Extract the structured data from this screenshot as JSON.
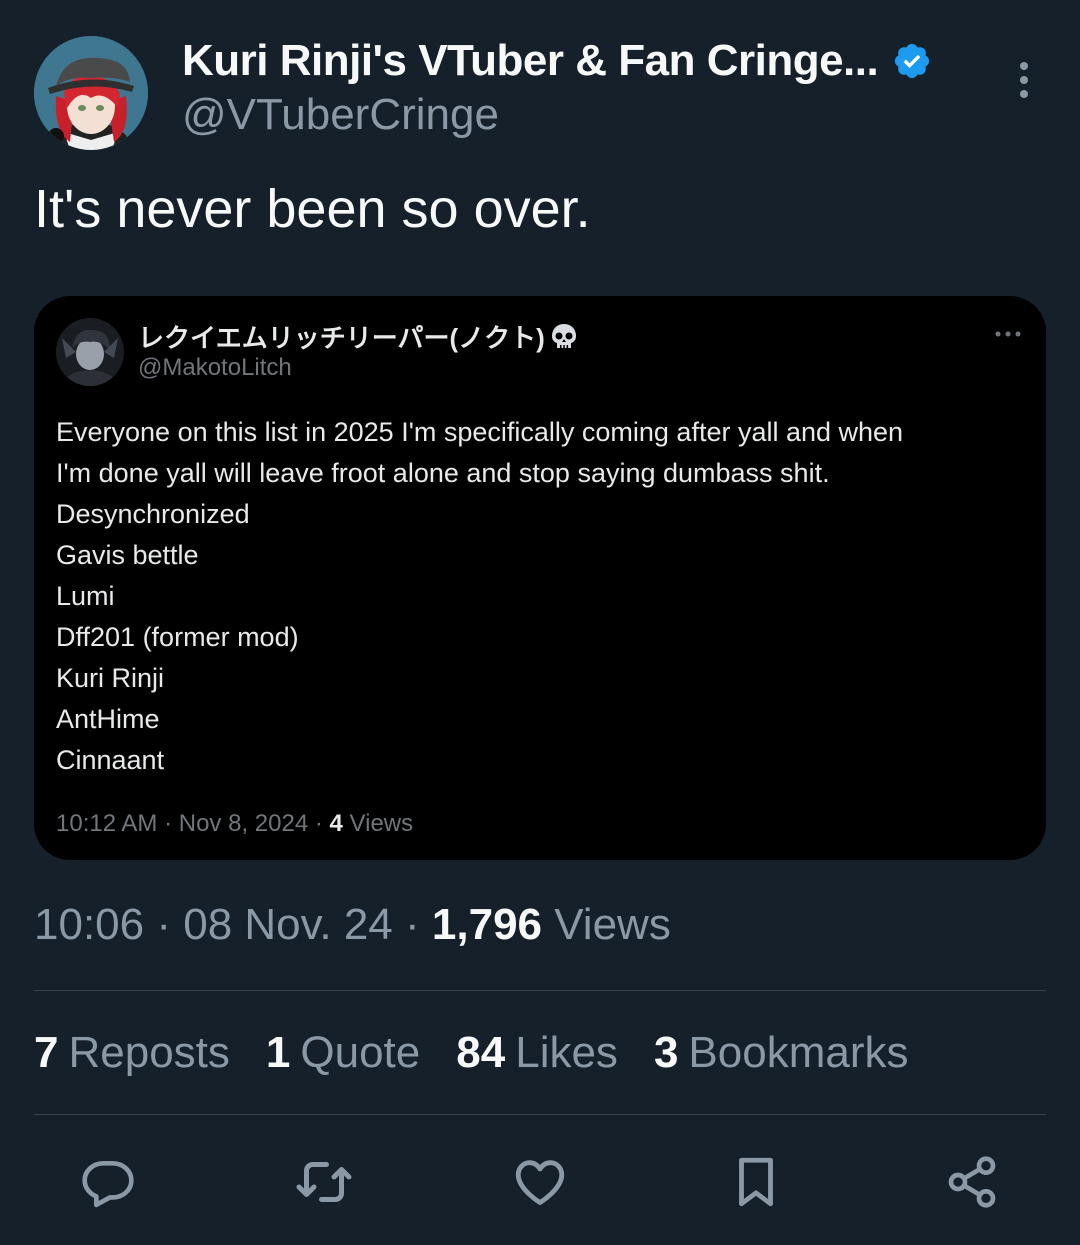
{
  "author": {
    "display_name": "Kuri Rinji's VTuber & Fan Cringe...",
    "handle": "@VTuberCringe",
    "verified": true,
    "verified_color": "#1d9bf0"
  },
  "tweet": {
    "text": "It's never been so over."
  },
  "quoted": {
    "display_name": "レクイエムリッチリーパー(ノクト)",
    "name_emoji": "skull-icon",
    "handle": "@MakotoLitch",
    "lines": [
      "Everyone on this list in 2025 I'm specifically coming after yall and when",
      "I'm done yall will leave froot alone and stop saying dumbass shit.",
      "Desynchronized",
      "Gavis bettle",
      "Lumi",
      "Dff201 (former mod)",
      "Kuri Rinji",
      "AntHime",
      "Cinnaant"
    ],
    "time": "10:12 AM",
    "date": "Nov 8, 2024",
    "views_count": "4",
    "views_label": "Views"
  },
  "meta": {
    "time": "10:06",
    "date": "08 Nov. 24",
    "views_count": "1,796",
    "views_label": "Views"
  },
  "stats": {
    "reposts_count": "7",
    "reposts_label": "Reposts",
    "quote_count": "1",
    "quote_label": "Quote",
    "likes_count": "84",
    "likes_label": "Likes",
    "bookmarks_count": "3",
    "bookmarks_label": "Bookmarks"
  },
  "actions": [
    "reply-icon",
    "repost-icon",
    "like-icon",
    "bookmark-icon",
    "share-icon"
  ],
  "colors": {
    "background": "#15202b",
    "quote_background": "#000000",
    "secondary_text": "#8b98a5",
    "divider": "#38444d",
    "icon": "#8b98a5"
  }
}
